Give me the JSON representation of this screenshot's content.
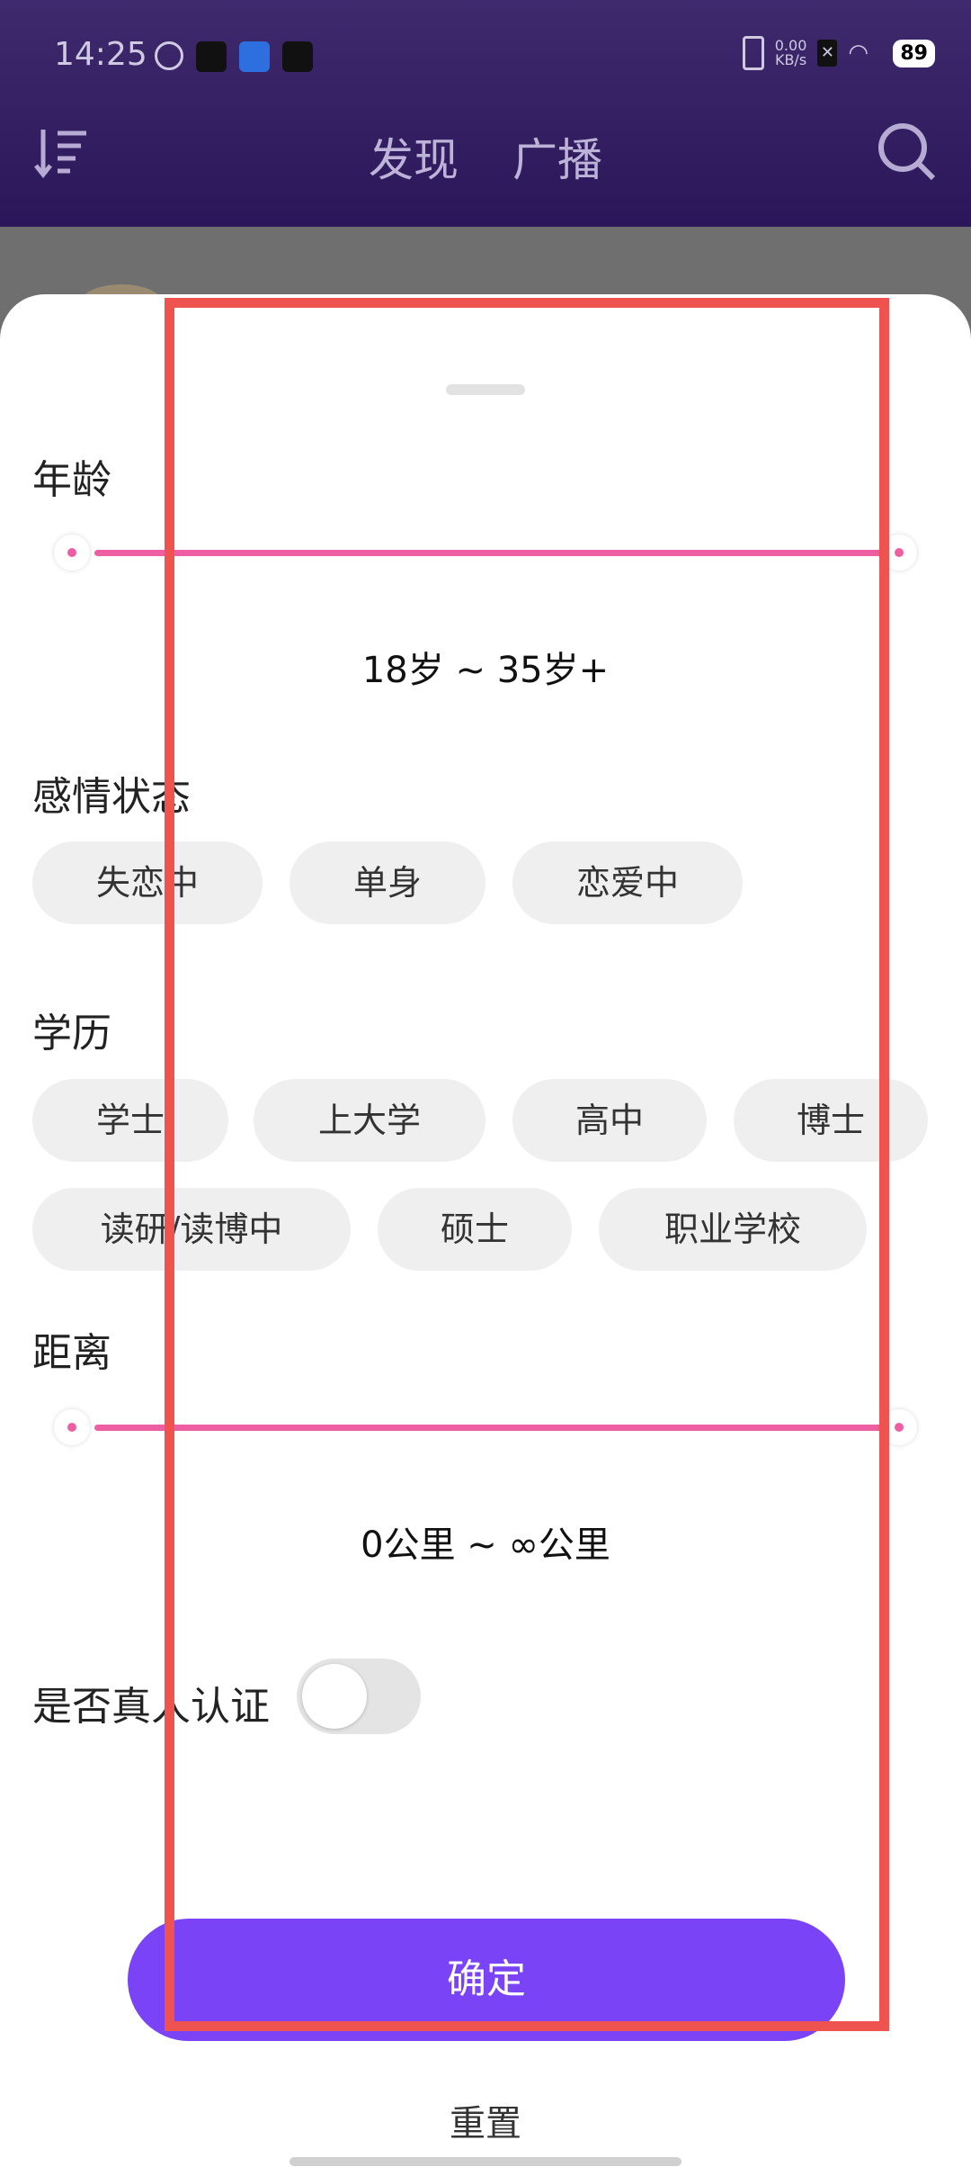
{
  "status_bar": {
    "time": "14:25",
    "net_speed_value": "0.00",
    "net_speed_unit": "KB/s",
    "battery": "89"
  },
  "nav": {
    "tabs": [
      "发现",
      "广播"
    ]
  },
  "filter": {
    "age": {
      "label": "年龄",
      "range_text": "18岁 ~ 35岁+",
      "min": 18,
      "max": "35+"
    },
    "relationship": {
      "label": "感情状态",
      "options": [
        "失恋中",
        "单身",
        "恋爱中"
      ]
    },
    "education": {
      "label": "学历",
      "options": [
        "学士",
        "上大学",
        "高中",
        "博士",
        "读研/读博中",
        "硕士",
        "职业学校"
      ]
    },
    "distance": {
      "label": "距离",
      "range_text": "0公里 ~ ∞公里"
    },
    "verified": {
      "label": "是否真人认证",
      "enabled": false
    },
    "confirm_label": "确定",
    "reset_label": "重置"
  },
  "colors": {
    "accent_purple": "#7a44f6",
    "slider_pink": "#ee5ea2",
    "header_bg": "#2a1658"
  }
}
